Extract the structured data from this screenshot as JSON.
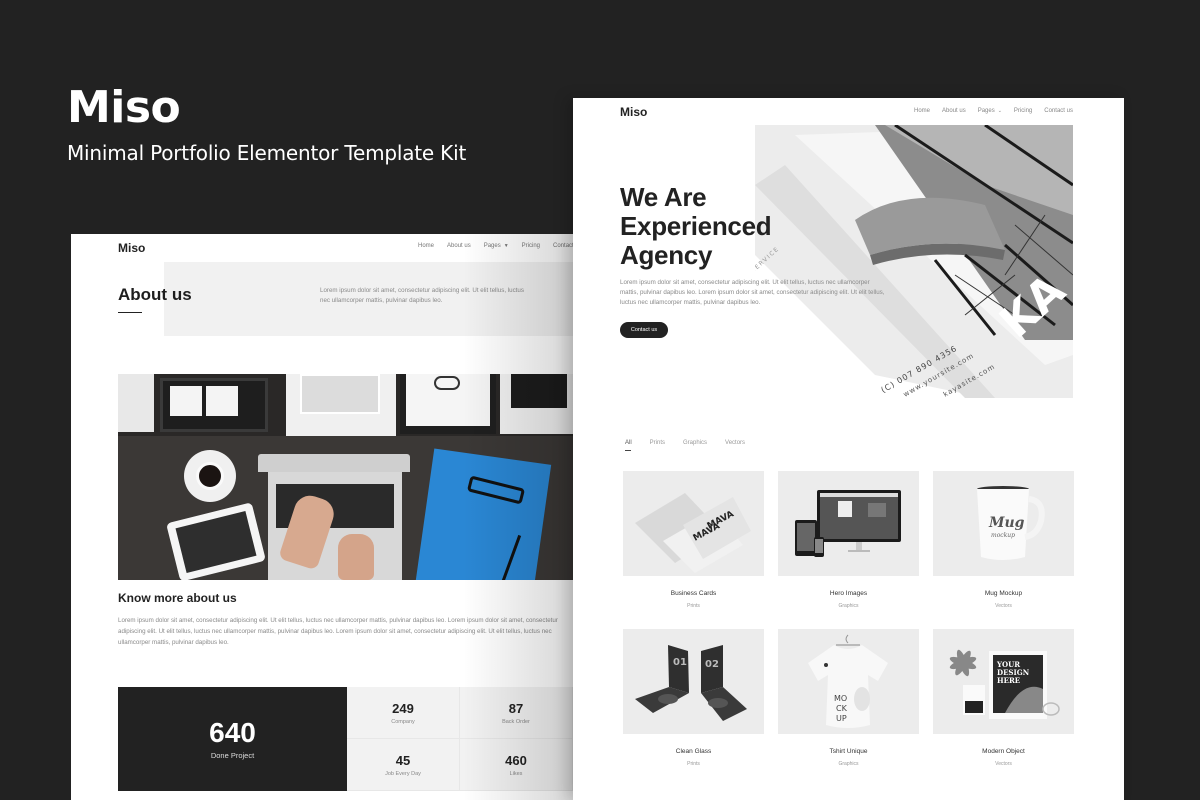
{
  "kit": {
    "title": "Miso",
    "subtitle": "Minimal Portfolio Elementor Template Kit"
  },
  "about_page": {
    "logo": "Miso",
    "nav": [
      {
        "label": "Home"
      },
      {
        "label": "About us"
      },
      {
        "label": "Pages",
        "has_dropdown": true
      },
      {
        "label": "Pricing"
      },
      {
        "label": "Contact us"
      }
    ],
    "hero_title": "About us",
    "hero_text": "Lorem ipsum dolor sit amet, consectetur adipiscing elit. Ut elit tellus, luctus nec ullamcorper mattis, pulvinar dapibus leo.",
    "photo_alt": "Workspace desk with laptop, tablet, coffee and blue folder",
    "section_title": "Know more about us",
    "section_text": "Lorem ipsum dolor sit amet, consectetur adipiscing elit. Ut elit tellus, luctus nec ullamcorper mattis, pulvinar dapibus leo. Lorem ipsum dolor sit amet, consectetur adipiscing elit. Ut elit tellus, luctus nec ullamcorper mattis, pulvinar dapibus leo. Lorem ipsum dolor sit amet, consectetur adipiscing elit. Ut elit tellus, luctus nec ullamcorper mattis, pulvinar dapibus leo.",
    "stats": {
      "main": {
        "value": "640",
        "label": "Done Project"
      },
      "items": [
        {
          "value": "249",
          "label": "Company"
        },
        {
          "value": "87",
          "label": "Back Order"
        },
        {
          "value": "45",
          "label": "Job Every Day"
        },
        {
          "value": "460",
          "label": "Likes"
        }
      ]
    }
  },
  "home_page": {
    "logo": "Miso",
    "nav": [
      {
        "label": "Home"
      },
      {
        "label": "About us"
      },
      {
        "label": "Pages",
        "has_dropdown": true
      },
      {
        "label": "Pricing"
      },
      {
        "label": "Contact us"
      }
    ],
    "hero_title_lines": [
      "We Are",
      "Experienced",
      "Agency"
    ],
    "hero_text": "Lorem ipsum dolor sit amet, consectetur adipiscing elit. Ut elit tellus, luctus nec ullamcorper mattis, pulvinar dapibus leo. Lorem ipsum dolor sit amet, consectetur adipiscing elit. Ut elit tellus, luctus nec ullamcorper mattis, pulvinar dapibus leo.",
    "cta_label": "Contact us",
    "hero_image": {
      "card_text_service": "SERVICE",
      "card_text_phone": "(C) 007 890 4356",
      "card_text_site1": "www.yoursite.com",
      "card_text_site2": "kayasite.com",
      "brand_letters": "KA"
    },
    "filters": [
      {
        "label": "All",
        "active": true
      },
      {
        "label": "Prints",
        "active": false
      },
      {
        "label": "Graphics",
        "active": false
      },
      {
        "label": "Vectors",
        "active": false
      }
    ],
    "portfolio": [
      {
        "title": "Business Cards",
        "category": "Prints",
        "icon": "business-cards-mockup"
      },
      {
        "title": "Hero Images",
        "category": "Graphics",
        "icon": "devices-mockup"
      },
      {
        "title": "Mug Mockup",
        "category": "Vectors",
        "icon": "mug-mockup",
        "mug_text": "Mug mockup"
      },
      {
        "title": "Clean Glass",
        "category": "Prints",
        "icon": "foldable-phones-mockup",
        "labels": [
          "01",
          "02"
        ]
      },
      {
        "title": "Tshirt Unique",
        "category": "Graphics",
        "icon": "tshirt-mockup",
        "shirt_text": "MOCK UP"
      },
      {
        "title": "Modern Object",
        "category": "Vectors",
        "icon": "poster-mockup",
        "poster_text": "YOUR DESIGN HERE"
      }
    ]
  }
}
